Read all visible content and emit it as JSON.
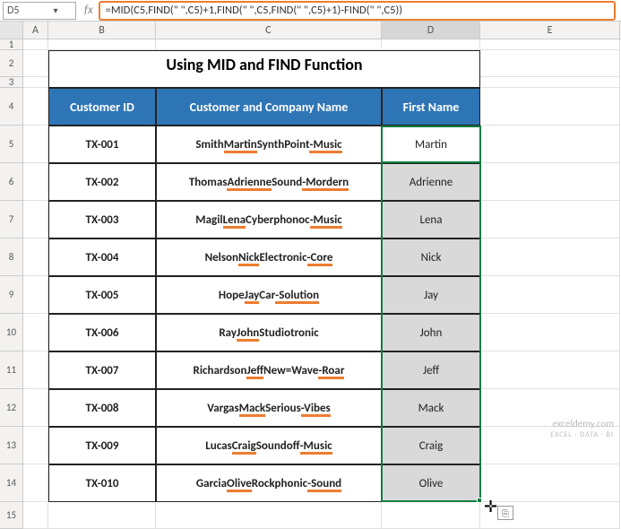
{
  "namebox": "D5",
  "formula": "=MID(C5,FIND(\" \",C5)+1,FIND(\" \",C5,FIND(\" \",C5)+1)-FIND(\" \",C5))",
  "title": "Using MID and FIND Function",
  "columns": [
    "A",
    "B",
    "C",
    "D",
    "E"
  ],
  "rowNums": [
    "1",
    "2",
    "3",
    "4",
    "5",
    "6",
    "7",
    "8",
    "9",
    "10",
    "11",
    "12",
    "13",
    "14",
    "15"
  ],
  "headers": {
    "id": "Customer ID",
    "cc": "Customer and Company Name",
    "fn": "First Name"
  },
  "data": [
    {
      "id": "TX-001",
      "p1": "Smith ",
      "p2": "Martin",
      "p3": " SynthPoint",
      "p4": "-Music",
      "fn": "Martin",
      "bg": ""
    },
    {
      "id": "TX-002",
      "p1": "Thomas ",
      "p2": "Adrienne",
      "p3": " Sound",
      "p4": "-Mordern",
      "fn": "Adrienne",
      "bg": "fn"
    },
    {
      "id": "TX-003",
      "p1": "Magil ",
      "p2": "Lena",
      "p3": " Cyberphonoc",
      "p4": "-Music",
      "fn": "Lena",
      "bg": "fn"
    },
    {
      "id": "TX-004",
      "p1": "Nelson ",
      "p2": "Nick",
      "p3": " Electronic",
      "p4": "-Core",
      "fn": "Nick",
      "bg": "fn"
    },
    {
      "id": "TX-005",
      "p1": "Hope ",
      "p2": "Jay",
      "p3": " Car",
      "p4": "-Solution",
      "fn": "Jay",
      "bg": "fn"
    },
    {
      "id": "TX-006",
      "p1": "Ray ",
      "p2": "John",
      "p3": " Studiotronic",
      "p4": "",
      "fn": "John",
      "bg": "fn"
    },
    {
      "id": "TX-007",
      "p1": "Richardson ",
      "p2": "Jeff",
      "p3": " New=Wave",
      "p4": "-Roar",
      "fn": "Jeff",
      "bg": "fn"
    },
    {
      "id": "TX-008",
      "p1": "Vargas ",
      "p2": "Mack",
      "p3": " Serious",
      "p4": "-Vibes",
      "fn": "Mack",
      "bg": "fn"
    },
    {
      "id": "TX-009",
      "p1": "Lucas ",
      "p2": "Craig",
      "p3": " Soundoff",
      "p4": "-Music",
      "fn": "Craig",
      "bg": "fn"
    },
    {
      "id": "TX-010",
      "p1": "Garcia ",
      "p2": "Olive",
      "p3": " Rockphonic",
      "p4": "-Sound",
      "fn": "Olive",
      "bg": "fn"
    }
  ],
  "watermark": {
    "l1": "exceldemy.com",
    "l2": "EXCEL · DATA · BI"
  },
  "icons": {
    "dd": "▾",
    "fx": "fx",
    "autofill": "⎘"
  }
}
